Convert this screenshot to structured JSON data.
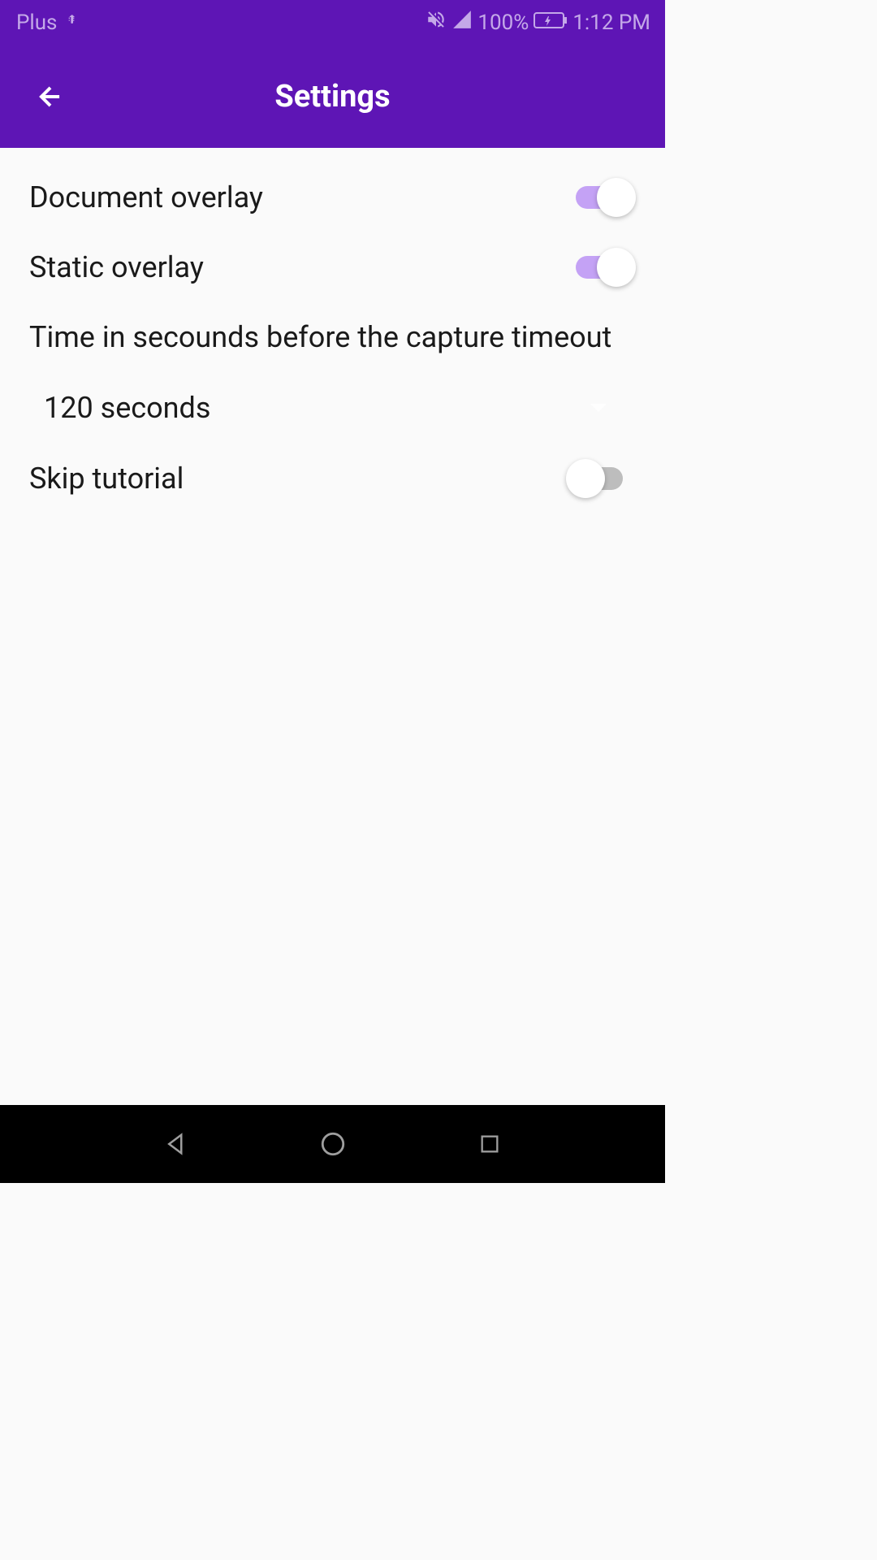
{
  "status_bar": {
    "carrier": "Plus",
    "battery": "100%",
    "time": "1:12 PM"
  },
  "header": {
    "title": "Settings"
  },
  "settings": {
    "document_overlay": {
      "label": "Document overlay",
      "enabled": true
    },
    "static_overlay": {
      "label": "Static overlay",
      "enabled": true
    },
    "timeout": {
      "label": "Time in secounds before the capture timeout",
      "selected": "120 seconds"
    },
    "skip_tutorial": {
      "label": "Skip tutorial",
      "enabled": false
    }
  }
}
